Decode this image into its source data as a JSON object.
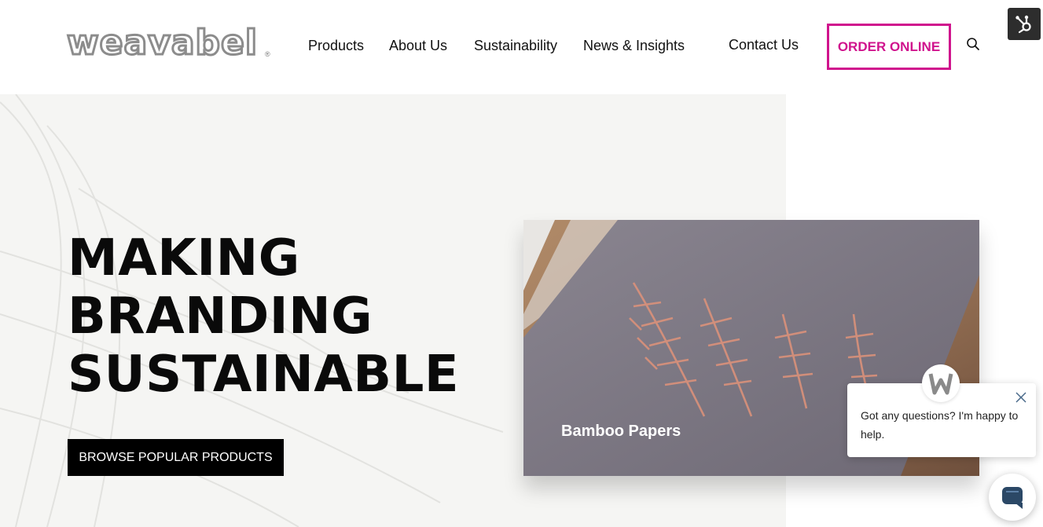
{
  "header": {
    "logo_text": "weavabel",
    "logo_reg": "®",
    "nav": [
      {
        "label": "Products"
      },
      {
        "label": "About Us"
      },
      {
        "label": "Sustainability"
      },
      {
        "label": "News & Insights"
      },
      {
        "label": "Contact Us"
      }
    ],
    "order_label": "ORDER ONLINE",
    "search_icon": "search-icon",
    "hubspot_icon": "hubspot-icon"
  },
  "hero": {
    "title_lines": [
      "MAKING",
      "BRANDING",
      "SUSTAINABLE"
    ],
    "browse_label": "BROWSE POPULAR PRODUCTS",
    "video_caption": "Bamboo Papers"
  },
  "chat": {
    "message": "Got any questions? I'm happy to help.",
    "close_icon": "close-icon",
    "avatar_icon": "weavabel-avatar-icon",
    "launcher_icon": "chat-icon"
  },
  "colors": {
    "accent": "#d0138d",
    "hero_bg": "#f5f5f3",
    "button_bg": "#000000"
  }
}
